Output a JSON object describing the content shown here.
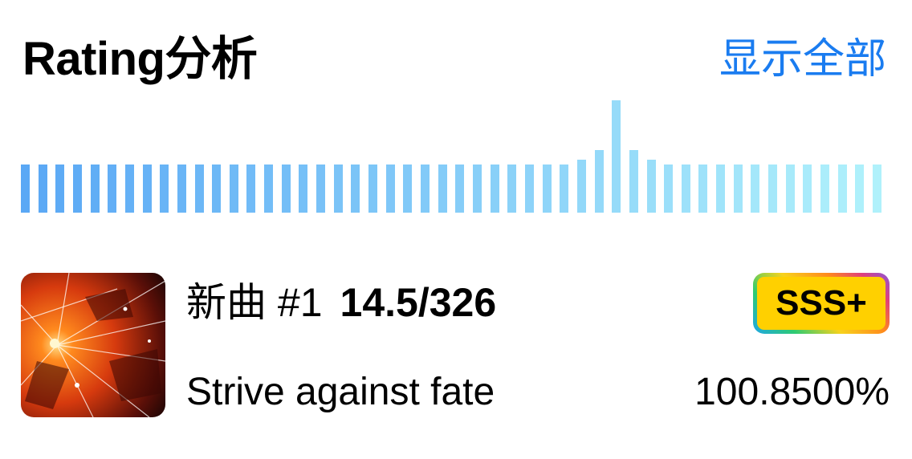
{
  "header": {
    "title": "Rating分析",
    "show_all_label": "显示全部",
    "accent_color": "#1a7cf0"
  },
  "rating_bars": {
    "relative_heights": [
      0.43,
      0.43,
      0.43,
      0.43,
      0.43,
      0.43,
      0.43,
      0.43,
      0.43,
      0.43,
      0.43,
      0.43,
      0.43,
      0.43,
      0.43,
      0.43,
      0.43,
      0.43,
      0.43,
      0.43,
      0.43,
      0.43,
      0.43,
      0.43,
      0.43,
      0.43,
      0.43,
      0.43,
      0.43,
      0.43,
      0.43,
      0.43,
      0.47,
      0.56,
      1.0,
      0.56,
      0.47,
      0.43,
      0.43,
      0.43,
      0.43,
      0.43,
      0.43,
      0.43,
      0.43,
      0.43,
      0.43,
      0.43,
      0.43,
      0.43
    ],
    "color_start": "#5aa8f5",
    "color_end": "#b0f1fb"
  },
  "song": {
    "category": "新曲 #1",
    "level_rating": "14.5/326",
    "name": "Strive against fate",
    "rank": "SSS+",
    "accuracy": "100.8500%",
    "badge_color": "#ffd000",
    "cover_icon": "album-cover-art"
  }
}
